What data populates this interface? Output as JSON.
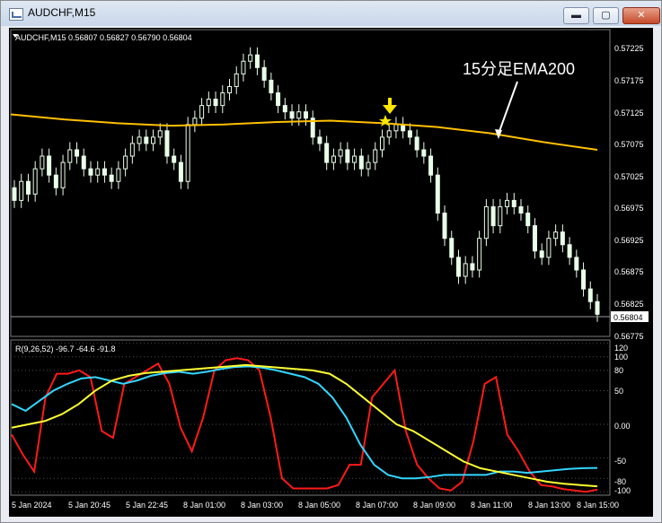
{
  "window": {
    "title": "AUDCHF,M15",
    "buttons": {
      "minimize": "▬",
      "maximize": "▢",
      "close": "✕"
    }
  },
  "main_panel": {
    "header": "AUDCHF,M15  0.56807 0.56827 0.56790 0.56804",
    "price_labels": [
      "0.57225",
      "0.57175",
      "0.57125",
      "0.57075",
      "0.57025",
      "0.56975",
      "0.56925",
      "0.56875",
      "0.56825",
      "0.56775"
    ],
    "current_price": "0.56804",
    "annotation": "15分足EMA200"
  },
  "indicator_panel": {
    "header": "R(9,26,52) -96.7 -64.6 -91.8",
    "scale_labels": [
      "120",
      "100",
      "80",
      "50",
      "0.00",
      "-50",
      "-80",
      "-100"
    ]
  },
  "time_labels": [
    "5 Jan 2024",
    "5 Jan 20:45",
    "5 Jan 22:45",
    "8 Jan 01:00",
    "8 Jan 03:00",
    "8 Jan 05:00",
    "8 Jan 07:00",
    "8 Jan 09:00",
    "8 Jan 11:00",
    "8 Jan 13:00",
    "8 Jan 15:00"
  ],
  "colors": {
    "candle": "#e8ffe8",
    "ema": "#ffc000",
    "indicator_red": "#ff1a1a",
    "indicator_cyan": "#33d6ff",
    "indicator_yellow": "#ffff33",
    "marker": "#ffe800",
    "grid": "#4d4d4d"
  },
  "chart_data": [
    {
      "type": "candlestick",
      "title": "AUDCHF,M15",
      "ylim": [
        0.56765,
        0.5725
      ],
      "ohlc_last": [
        0.56807,
        0.56827,
        0.5679,
        0.56804
      ],
      "x_ticks": [
        "5 Jan 2024",
        "5 Jan 20:45",
        "5 Jan 22:45",
        "8 Jan 01:00",
        "8 Jan 03:00",
        "8 Jan 05:00",
        "8 Jan 07:00",
        "8 Jan 09:00",
        "8 Jan 11:00",
        "8 Jan 13:00",
        "8 Jan 15:00"
      ],
      "close": [
        0.5698,
        0.5701,
        0.5699,
        0.5703,
        0.5705,
        0.5702,
        0.57,
        0.5704,
        0.5706,
        0.5705,
        0.5703,
        0.5702,
        0.5703,
        0.5702,
        0.5701,
        0.5703,
        0.5705,
        0.5707,
        0.5708,
        0.5707,
        0.5708,
        0.5709,
        0.5705,
        0.5704,
        0.5701,
        0.571,
        0.5711,
        0.5713,
        0.5714,
        0.5713,
        0.5715,
        0.5716,
        0.5718,
        0.572,
        0.5721,
        0.5719,
        0.5717,
        0.5715,
        0.5713,
        0.5712,
        0.5711,
        0.5712,
        0.5711,
        0.5708,
        0.5707,
        0.5704,
        0.5705,
        0.5706,
        0.5704,
        0.5705,
        0.5703,
        0.5704,
        0.5706,
        0.5708,
        0.5709,
        0.571,
        0.5709,
        0.5708,
        0.5706,
        0.5705,
        0.5702,
        0.5696,
        0.5692,
        0.5689,
        0.5686,
        0.5688,
        0.5687,
        0.5692,
        0.5697,
        0.5694,
        0.5697,
        0.5698,
        0.5697,
        0.5696,
        0.5694,
        0.569,
        0.5689,
        0.5692,
        0.5693,
        0.5691,
        0.5689,
        0.5687,
        0.5684,
        0.5682,
        0.568
      ],
      "series": [
        {
          "name": "EMA200",
          "y": [
            0.57116,
            0.57108,
            0.57102,
            0.57098,
            0.571,
            0.57104,
            0.57106,
            0.57102,
            0.57096,
            0.57086,
            0.57072,
            0.5706
          ]
        }
      ],
      "annotation": "15分足EMA200"
    },
    {
      "type": "line",
      "title": "R(9,26,52) -96.7 -64.6 -91.8",
      "ylim": [
        -105,
        125
      ],
      "y_ticks": [
        120,
        100,
        80,
        50,
        0,
        -50,
        -80,
        -100
      ],
      "series": [
        {
          "values": [
            -15,
            -45,
            -70,
            40,
            75,
            75,
            80,
            70,
            -10,
            -20,
            60,
            70,
            80,
            90,
            60,
            -5,
            -40,
            10,
            80,
            95,
            98,
            95,
            80,
            10,
            -80,
            -95,
            -95,
            -95,
            -95,
            -90,
            -60,
            -60,
            40,
            60,
            80,
            -10,
            -60,
            -80,
            -95,
            -98,
            -85,
            -25,
            60,
            70,
            -15,
            -40,
            -70,
            -90,
            -92,
            -96,
            -98,
            -100,
            -96.7
          ]
        },
        {
          "values": [
            30,
            20,
            35,
            50,
            60,
            68,
            70,
            65,
            60,
            65,
            72,
            76,
            78,
            75,
            78,
            82,
            85,
            86,
            84,
            80,
            75,
            70,
            60,
            40,
            10,
            -30,
            -60,
            -75,
            -80,
            -80,
            -78,
            -75,
            -75,
            -75,
            -75,
            -70,
            -70,
            -72,
            -70,
            -68,
            -66,
            -65,
            -64.6
          ]
        },
        {
          "values": [
            -5,
            0,
            5,
            15,
            30,
            50,
            65,
            72,
            76,
            78,
            80,
            82,
            84,
            86,
            88,
            86,
            84,
            82,
            80,
            75,
            60,
            40,
            20,
            0,
            -10,
            -25,
            -40,
            -55,
            -65,
            -70,
            -75,
            -80,
            -85,
            -88,
            -90,
            -91.8
          ]
        }
      ]
    }
  ]
}
